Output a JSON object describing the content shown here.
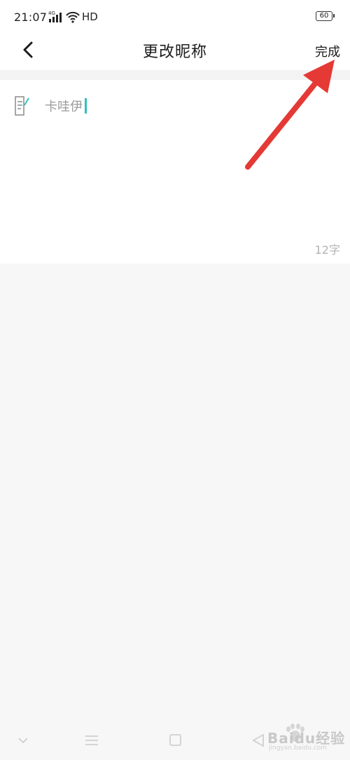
{
  "status_bar": {
    "time": "21:07",
    "network": "4G",
    "hd": "HD",
    "battery": "60"
  },
  "nav": {
    "back_icon": "chevron-left-icon",
    "title": "更改昵称",
    "done_label": "完成"
  },
  "form": {
    "field_icon": "edit-note-icon",
    "nickname_value": "卡哇伊",
    "char_count": "12字"
  },
  "bottom_nav": {
    "items": [
      "chevron-down-icon",
      "menu-icon",
      "square-icon",
      "back-triangle-icon"
    ]
  },
  "watermark": {
    "brand": "Baidu经验",
    "url": "jingyan.baidu.com"
  },
  "colors": {
    "accent": "#2bc2c0",
    "annotation_arrow": "#e53935",
    "background": "#f7f7f7",
    "surface": "#ffffff"
  }
}
